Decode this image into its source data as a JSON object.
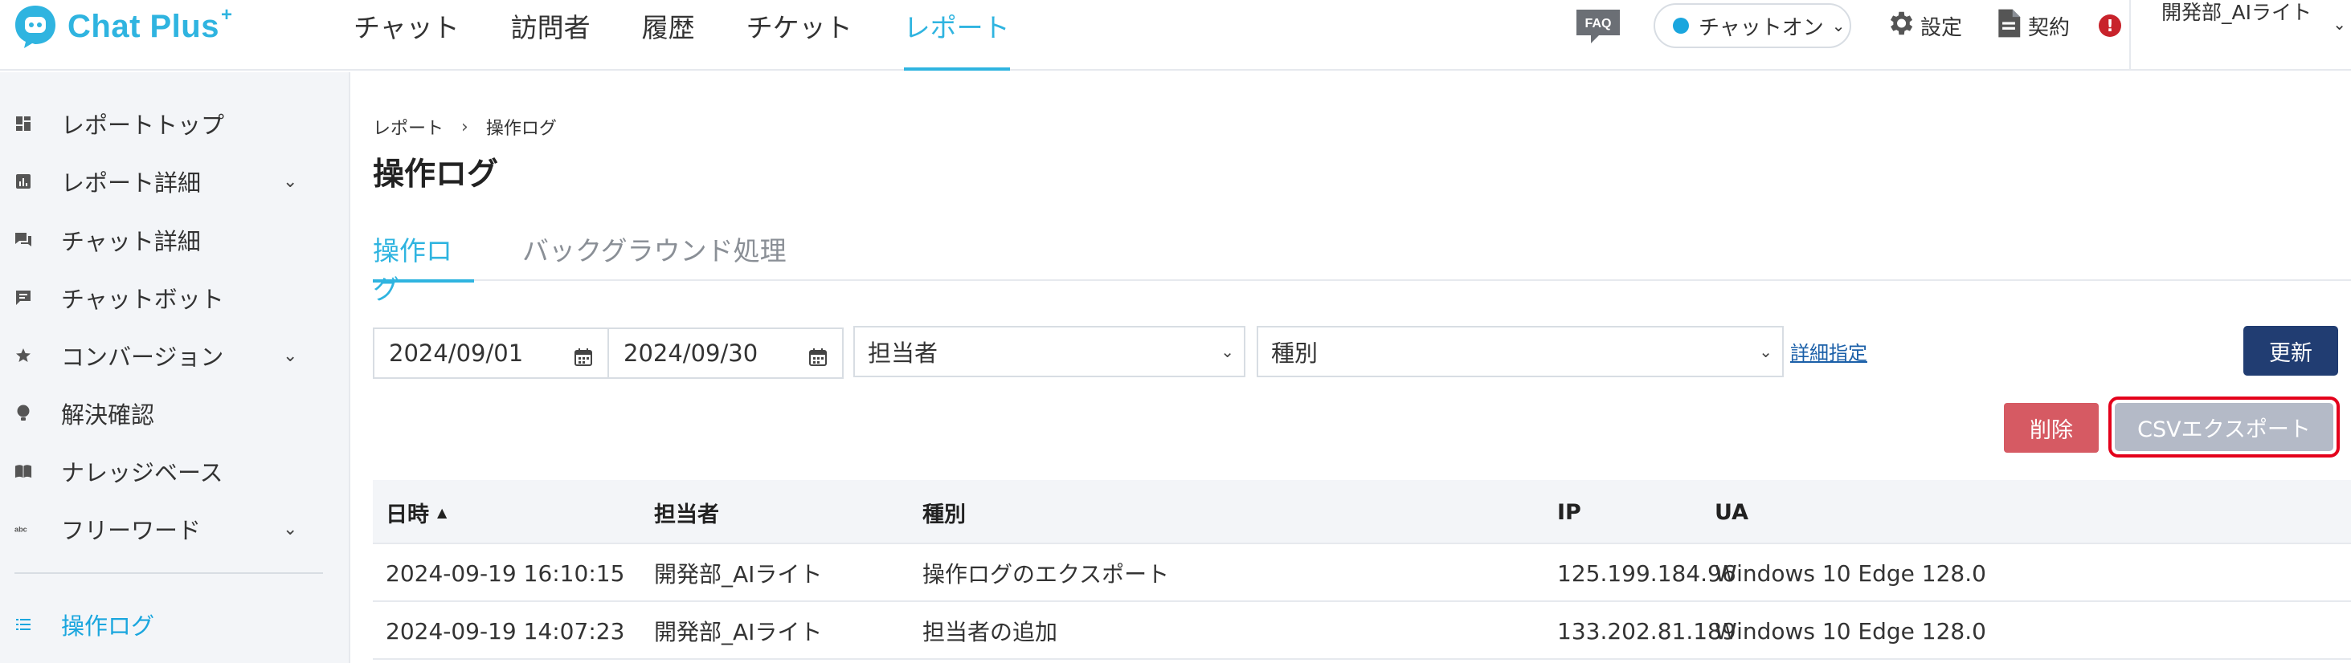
{
  "app": {
    "brand": "Chat Plus",
    "brand_sup": "+"
  },
  "header": {
    "nav": [
      {
        "label": "チャット"
      },
      {
        "label": "訪問者"
      },
      {
        "label": "履歴"
      },
      {
        "label": "チケット"
      },
      {
        "label": "レポート",
        "active": true
      }
    ],
    "faq_label": "FAQ",
    "status_label": "チャットオン",
    "settings_label": "設定",
    "contract_label": "契約",
    "alert_label": "!",
    "user_label": "開発部_AIライト"
  },
  "sidebar": {
    "items": [
      {
        "label": "レポートトップ",
        "icon": "dashboard-icon",
        "chevron": false
      },
      {
        "label": "レポート詳細",
        "icon": "chart-icon",
        "chevron": true
      },
      {
        "label": "チャット詳細",
        "icon": "chat-bubbles-icon",
        "chevron": false
      },
      {
        "label": "チャットボット",
        "icon": "bot-message-icon",
        "chevron": false
      },
      {
        "label": "コンバージョン",
        "icon": "star-icon",
        "chevron": true
      },
      {
        "label": "解決確認",
        "icon": "lightbulb-icon",
        "chevron": false
      },
      {
        "label": "ナレッジベース",
        "icon": "book-icon",
        "chevron": false
      },
      {
        "label": "フリーワード",
        "icon": "abc-icon",
        "chevron": true
      }
    ],
    "active_item": {
      "label": "操作ログ",
      "icon": "list-icon"
    }
  },
  "main": {
    "breadcrumb": {
      "parent": "レポート",
      "separator": "›",
      "current": "操作ログ"
    },
    "title": "操作ログ",
    "tabs": [
      {
        "label": "操作ログ",
        "active": true
      },
      {
        "label": "バックグラウンド処理",
        "active": false
      }
    ],
    "filters": {
      "date_from": "2024/09/01",
      "date_to": "2024/09/30",
      "operator_select": "担当者",
      "type_select": "種別",
      "detail_link": "詳細指定"
    },
    "buttons": {
      "refresh": "更新",
      "delete": "削除",
      "csv_export": "CSVエクスポート"
    },
    "table": {
      "columns": [
        "日時",
        "担当者",
        "種別",
        "IP",
        "UA"
      ],
      "sort_indicator": "▲",
      "rows": [
        [
          "2024-09-19 16:10:15",
          "開発部_AIライト",
          "操作ログのエクスポート",
          "125.199.184.96",
          "Windows 10 Edge 128.0"
        ],
        [
          "2024-09-19 14:07:23",
          "開発部_AIライト",
          "担当者の追加",
          "133.202.81.189",
          "Windows 10 Edge 128.0"
        ]
      ]
    }
  },
  "colors": {
    "accent": "#2fb4e0",
    "primary_button": "#213d72",
    "delete_button": "#d65a63",
    "csv_button": "#b4bac7",
    "highlight_border": "#e4001b",
    "alert": "#c8232b"
  }
}
